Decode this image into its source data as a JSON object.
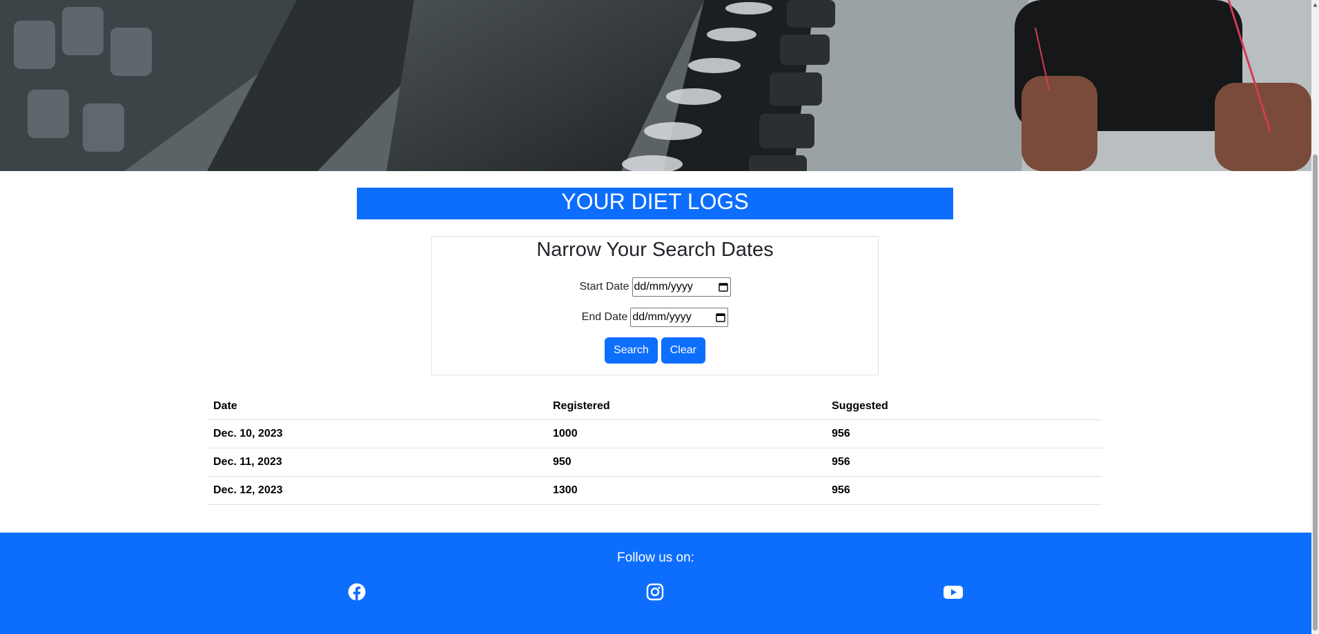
{
  "page": {
    "title": "YOUR DIET LOGS"
  },
  "search": {
    "heading": "Narrow Your Search Dates",
    "start_label": "Start Date",
    "start_placeholder": "dd/mm/yyyy",
    "end_label": "End Date",
    "end_placeholder": "dd/mm/yyyy",
    "search_button": "Search",
    "clear_button": "Clear"
  },
  "table": {
    "headers": [
      "Date",
      "Registered",
      "Suggested"
    ],
    "rows": [
      [
        "Dec. 10, 2023",
        "1000",
        "956"
      ],
      [
        "Dec. 11, 2023",
        "950",
        "956"
      ],
      [
        "Dec. 12, 2023",
        "1300",
        "956"
      ]
    ]
  },
  "footer": {
    "follow_text": "Follow us on:",
    "social_icons": [
      "facebook-icon",
      "instagram-icon",
      "youtube-icon"
    ]
  },
  "colors": {
    "primary": "#0d6efd",
    "border": "#dee2e6"
  }
}
